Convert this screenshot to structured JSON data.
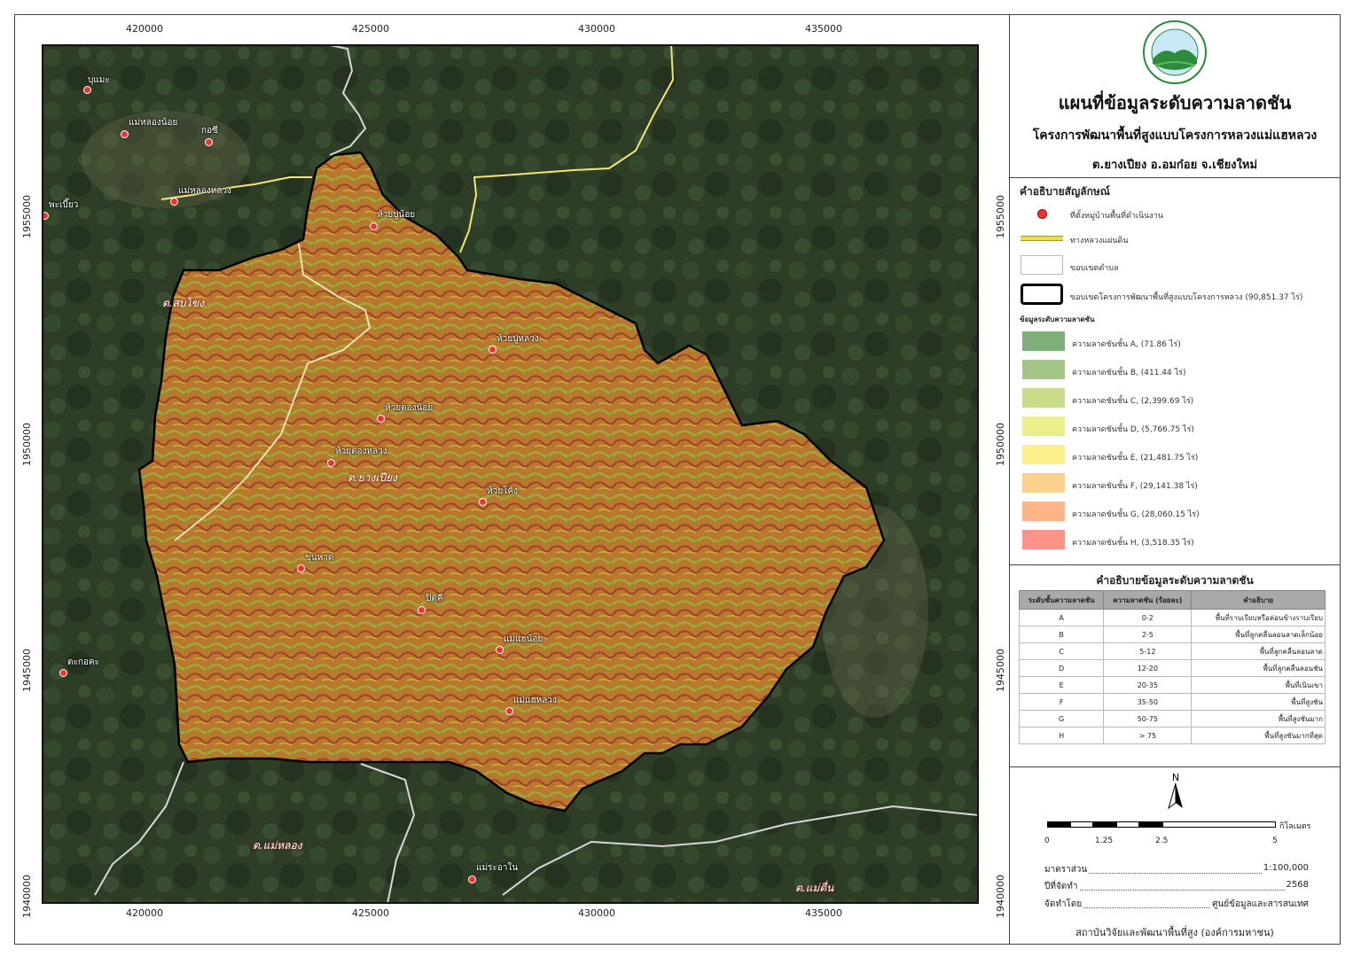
{
  "title": {
    "main": "แผนที่ข้อมูลระดับความลาดชัน",
    "sub": "โครงการพัฒนาพื้นที่สูงแบบโครงการหลวงแม่แฮหลวง",
    "location": "ต.ยางเปียง อ.อมก๋อย จ.เชียงใหม่"
  },
  "axes": {
    "x_ticks": [
      "420000",
      "425000",
      "430000",
      "435000"
    ],
    "y_ticks": [
      "1955000",
      "1950000",
      "1945000",
      "1940000"
    ]
  },
  "villages": [
    {
      "name": "บุแมะ"
    },
    {
      "name": "แม่หลองน้อย"
    },
    {
      "name": "กอซี"
    },
    {
      "name": "แม่หลองหลวง"
    },
    {
      "name": "พะเบี๊ยว"
    },
    {
      "name": "ห้วยปูน้อย"
    },
    {
      "name": "ห้วยปูหลวง"
    },
    {
      "name": "ห้วยตองน้อย"
    },
    {
      "name": "ห้วยตองหลวง"
    },
    {
      "name": "ห้วยโค้ง"
    },
    {
      "name": "ขุนหาด"
    },
    {
      "name": "ปิตุคี"
    },
    {
      "name": "แม่แฮน้อย"
    },
    {
      "name": "แม่แฮหลวง"
    },
    {
      "name": "ตะกอคะ"
    },
    {
      "name": "แม่ระอาใน"
    }
  ],
  "subdistricts": [
    "ต.สบโขง",
    "ต.ยางเปียง",
    "ต.แม่หลอง",
    "ต.แม่ตื่น"
  ],
  "legend": {
    "heading": "คำอธิบายสัญลักษณ์",
    "village": "ที่ตั้งหมู่บ้านพื้นที่ดำเนินงาน",
    "road": "ทางหลวงแผ่นดิน",
    "subdistrict_boundary": "ขอบเขตตำบล",
    "project_boundary": "ขอบเขตโครงการพัฒนาพื้นที่สูงแบบโครงการหลวง (90,851.37 ไร่)",
    "slope_heading": "ข้อมูลระดับความลาดชัน",
    "classes": [
      {
        "label": "ความลาดชันชั้น  A, (71.86 ไร่)",
        "color": "#7fae7a"
      },
      {
        "label": "ความลาดชันชั้น  B, (411.44 ไร่)",
        "color": "#a4c586"
      },
      {
        "label": "ความลาดชันชั้น  C, (2,399.69 ไร่)",
        "color": "#c8dc8a"
      },
      {
        "label": "ความลาดชันชั้น  D, (5,766.75 ไร่)",
        "color": "#ebef8a"
      },
      {
        "label": "ความลาดชันชั้น  E, (21,481.75 ไร่)",
        "color": "#fbf08a"
      },
      {
        "label": "ความลาดชันชั้น  F, (29,141.38 ไร่)",
        "color": "#fcd18a"
      },
      {
        "label": "ความลาดชันชั้น  G, (28,060.15 ไร่)",
        "color": "#fdb587"
      },
      {
        "label": "ความลาดชันชั้น  H, (3,518.35 ไร่)",
        "color": "#fb9486"
      }
    ]
  },
  "table": {
    "title": "คำอธิบายข้อมูลระดับความลาดชัน",
    "headers": [
      "ระดับชั้นความลาดชัน",
      "ความลาดชัน (ร้อยละ)",
      "คำอธิบาย"
    ],
    "rows": [
      [
        "A",
        "0-2",
        "พื้นที่ราบเรียบหรือค่อนข้างราบเรียบ"
      ],
      [
        "B",
        "2-5",
        "พื้นที่ลูกคลื่นลอนลาดเล็กน้อย"
      ],
      [
        "C",
        "5-12",
        "พื้นที่ลูกคลื่นลอนลาด"
      ],
      [
        "D",
        "12-20",
        "พื้นที่ลูกคลื่นลอนชัน"
      ],
      [
        "E",
        "20-35",
        "พื้นที่เนินเขา"
      ],
      [
        "F",
        "35-50",
        "พื้นที่สูงชัน"
      ],
      [
        "G",
        "50-75",
        "พื้นที่สูงชันมาก"
      ],
      [
        "H",
        "> 75",
        "พื้นที่สูงชันมากที่สุด"
      ]
    ]
  },
  "scalebar": {
    "north": "N",
    "labels": [
      "0",
      "1.25",
      "2.5",
      "5"
    ],
    "unit": "กิโลเมตร"
  },
  "info": {
    "scale_label": "มาตราส่วน",
    "scale_value": "1:100,000",
    "year_label": "ปีที่จัดทำ",
    "year_value": "2568",
    "by_label": "จัดทำโดย",
    "by_value": "ศูนย์ข้อมูลและสารสนเทศ"
  },
  "organization": "สถาบันวิจัยและพัฒนาพื้นที่สูง (องค์การมหาชน)"
}
